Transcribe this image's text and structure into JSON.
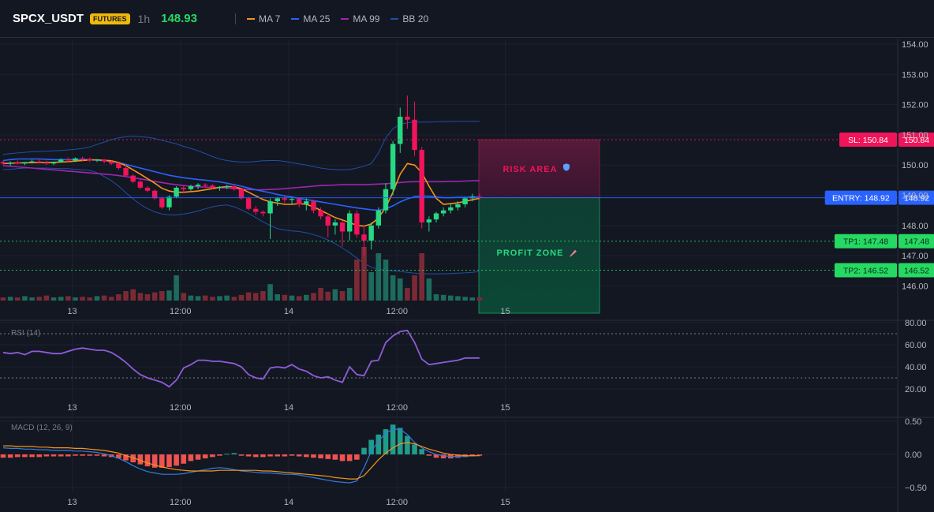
{
  "header": {
    "symbol": "SPCX_USDT",
    "badge": "FUTURES",
    "timeframe": "1h",
    "last_price": "148.93",
    "indicators": [
      {
        "label": "MA 7",
        "color": "#f7931a"
      },
      {
        "label": "MA 25",
        "color": "#2962ff"
      },
      {
        "label": "MA 99",
        "color": "#9c27b0"
      },
      {
        "label": "BB 20",
        "color": "#1e4fa8"
      }
    ]
  },
  "colors": {
    "up": "#26d982",
    "down": "#f0145a",
    "vol_up": "#1c6b5c",
    "vol_down": "#7a2a35",
    "bb": "#1e4fa8",
    "rsi": "#8e5cd9",
    "macd_line": "#2f7de0",
    "signal_line": "#f7931a"
  },
  "chart_data": [
    {
      "type": "candlestick",
      "title": "",
      "ylim": [
        145.6,
        154.2
      ],
      "yticks": [
        "154.00",
        "153.00",
        "152.00",
        "151.00",
        "150.00",
        "149.00",
        "148.00",
        "147.00",
        "146.00"
      ],
      "xticks": [
        "13",
        "12:00",
        "14",
        "12:00",
        "15"
      ],
      "xlim": [
        0,
        66
      ],
      "xtick_positions": [
        10,
        25,
        40,
        55,
        70
      ],
      "candles": [
        [
          150.1,
          150.15,
          150.0,
          150.05
        ],
        [
          150.05,
          150.12,
          149.98,
          150.08
        ],
        [
          150.08,
          150.15,
          150.02,
          150.05
        ],
        [
          150.05,
          150.1,
          150.0,
          150.1
        ],
        [
          150.1,
          150.18,
          150.05,
          150.12
        ],
        [
          150.12,
          150.2,
          150.05,
          150.08
        ],
        [
          150.08,
          150.15,
          150.0,
          150.05
        ],
        [
          150.05,
          150.12,
          150.0,
          150.1
        ],
        [
          150.1,
          150.22,
          150.08,
          150.18
        ],
        [
          150.18,
          150.25,
          150.1,
          150.15
        ],
        [
          150.15,
          150.25,
          150.1,
          150.22
        ],
        [
          150.22,
          150.28,
          150.12,
          150.2
        ],
        [
          150.2,
          150.25,
          150.1,
          150.15
        ],
        [
          150.15,
          150.2,
          150.1,
          150.18
        ],
        [
          150.18,
          150.2,
          150.05,
          150.12
        ],
        [
          150.12,
          150.15,
          150.0,
          150.05
        ],
        [
          150.05,
          150.1,
          149.85,
          149.9
        ],
        [
          149.9,
          150.0,
          149.6,
          149.65
        ],
        [
          149.65,
          149.7,
          149.4,
          149.45
        ],
        [
          149.45,
          149.5,
          149.2,
          149.25
        ],
        [
          149.25,
          149.3,
          149.1,
          149.15
        ],
        [
          149.15,
          149.2,
          148.85,
          148.9
        ],
        [
          148.9,
          148.95,
          148.55,
          148.6
        ],
        [
          148.6,
          149.0,
          148.5,
          148.95
        ],
        [
          148.95,
          149.3,
          148.9,
          149.25
        ],
        [
          149.25,
          149.3,
          149.1,
          149.2
        ],
        [
          149.2,
          149.35,
          149.15,
          149.3
        ],
        [
          149.3,
          149.4,
          149.2,
          149.35
        ],
        [
          149.35,
          149.4,
          149.25,
          149.32
        ],
        [
          149.32,
          149.38,
          149.2,
          149.25
        ],
        [
          149.25,
          149.3,
          149.15,
          149.28
        ],
        [
          149.28,
          149.35,
          149.2,
          149.3
        ],
        [
          149.3,
          149.35,
          149.15,
          149.2
        ],
        [
          149.2,
          149.25,
          148.85,
          148.9
        ],
        [
          148.9,
          148.95,
          148.5,
          148.55
        ],
        [
          148.55,
          148.65,
          148.35,
          148.45
        ],
        [
          148.45,
          148.5,
          148.3,
          148.4
        ],
        [
          148.4,
          148.9,
          147.55,
          148.8
        ],
        [
          148.8,
          148.95,
          148.65,
          148.9
        ],
        [
          148.9,
          149.0,
          148.75,
          148.85
        ],
        [
          148.85,
          148.95,
          148.7,
          148.88
        ],
        [
          148.88,
          148.9,
          148.6,
          148.7
        ],
        [
          148.7,
          148.9,
          148.5,
          148.8
        ],
        [
          148.8,
          148.85,
          148.4,
          148.5
        ],
        [
          148.5,
          148.6,
          148.2,
          148.3
        ],
        [
          148.3,
          148.4,
          147.6,
          148.0
        ],
        [
          148.0,
          148.2,
          147.7,
          148.1
        ],
        [
          148.1,
          148.15,
          147.3,
          147.8
        ],
        [
          147.8,
          148.5,
          147.5,
          148.4
        ],
        [
          148.4,
          148.5,
          147.6,
          147.7
        ],
        [
          147.7,
          148.0,
          147.0,
          147.5
        ],
        [
          147.5,
          148.1,
          147.2,
          148.0
        ],
        [
          148.0,
          148.6,
          147.9,
          148.5
        ],
        [
          148.5,
          149.4,
          148.4,
          149.2
        ],
        [
          149.2,
          150.8,
          149.0,
          150.7
        ],
        [
          150.7,
          151.9,
          150.4,
          151.6
        ],
        [
          151.6,
          152.3,
          151.2,
          151.5
        ],
        [
          151.5,
          152.1,
          150.3,
          150.5
        ],
        [
          150.5,
          150.6,
          147.9,
          148.1
        ],
        [
          148.1,
          148.3,
          147.8,
          148.2
        ],
        [
          148.2,
          148.45,
          148.1,
          148.4
        ],
        [
          148.4,
          148.6,
          148.3,
          148.5
        ],
        [
          148.5,
          148.7,
          148.4,
          148.6
        ],
        [
          148.6,
          148.8,
          148.5,
          148.7
        ],
        [
          148.7,
          148.95,
          148.6,
          148.9
        ],
        [
          148.9,
          149.05,
          148.8,
          148.95
        ],
        [
          148.95,
          149.05,
          148.85,
          148.93
        ]
      ],
      "ma7": [
        150.05,
        150.06,
        150.07,
        150.07,
        150.08,
        150.08,
        150.08,
        150.09,
        150.1,
        150.11,
        150.13,
        150.15,
        150.17,
        150.17,
        150.16,
        150.14,
        150.08,
        149.98,
        149.84,
        149.7,
        149.55,
        149.4,
        149.23,
        149.14,
        149.1,
        149.1,
        149.12,
        149.14,
        149.18,
        149.22,
        149.26,
        149.29,
        149.28,
        149.22,
        149.1,
        148.98,
        148.86,
        148.78,
        148.74,
        148.7,
        148.7,
        148.72,
        148.7,
        148.62,
        148.5,
        148.38,
        148.26,
        148.18,
        148.1,
        148.0,
        147.98,
        148.05,
        148.25,
        148.6,
        149.1,
        149.7,
        150.05,
        150.0,
        149.75,
        149.3,
        148.9,
        148.7,
        148.72,
        148.75,
        148.8,
        148.85,
        148.9
      ],
      "ma25": [
        150.15,
        150.18,
        150.2,
        150.2,
        150.2,
        150.2,
        150.19,
        150.18,
        150.18,
        150.18,
        150.18,
        150.18,
        150.18,
        150.16,
        150.14,
        150.12,
        150.08,
        150.02,
        149.96,
        149.9,
        149.84,
        149.78,
        149.72,
        149.66,
        149.62,
        149.58,
        149.55,
        149.52,
        149.5,
        149.47,
        149.44,
        149.4,
        149.35,
        149.3,
        149.24,
        149.18,
        149.13,
        149.08,
        149.03,
        148.98,
        148.94,
        148.9,
        148.86,
        148.82,
        148.78,
        148.74,
        148.7,
        148.66,
        148.62,
        148.58,
        148.55,
        148.52,
        148.5,
        148.55,
        148.65,
        148.78,
        148.88,
        148.95,
        148.98,
        148.96,
        148.94,
        148.92,
        148.92,
        148.93,
        148.93,
        148.94,
        148.94
      ],
      "ma99": [
        149.98,
        149.96,
        149.94,
        149.92,
        149.9,
        149.88,
        149.86,
        149.84,
        149.82,
        149.8,
        149.78,
        149.76,
        149.74,
        149.72,
        149.7,
        149.68,
        149.65,
        149.62,
        149.58,
        149.54,
        149.5,
        149.46,
        149.42,
        149.38,
        149.35,
        149.32,
        149.3,
        149.28,
        149.27,
        149.26,
        149.25,
        149.24,
        149.22,
        149.2,
        149.19,
        149.18,
        149.18,
        149.19,
        149.2,
        149.22,
        149.24,
        149.26,
        149.28,
        149.3,
        149.32,
        149.33,
        149.34,
        149.35,
        149.35,
        149.35,
        149.35,
        149.36,
        149.37,
        149.38,
        149.4,
        149.42,
        149.44,
        149.45,
        149.45,
        149.45,
        149.45,
        149.45,
        149.46,
        149.46,
        149.47,
        149.48,
        149.48
      ],
      "bb_upper": [
        150.35,
        150.38,
        150.4,
        150.42,
        150.44,
        150.45,
        150.46,
        150.47,
        150.48,
        150.5,
        150.52,
        150.55,
        150.6,
        150.68,
        150.76,
        150.84,
        150.9,
        150.94,
        150.95,
        150.94,
        150.92,
        150.88,
        150.82,
        150.76,
        150.7,
        150.62,
        150.55,
        150.47,
        150.38,
        150.28,
        150.2,
        150.15,
        150.12,
        150.1,
        150.1,
        150.12,
        150.14,
        150.15,
        150.15,
        150.12,
        150.08,
        150.04,
        150.0,
        149.95,
        149.9,
        149.87,
        149.85,
        149.84,
        149.85,
        149.9,
        149.96,
        150.05,
        150.4,
        150.9,
        151.2,
        151.35,
        151.4,
        151.42,
        151.42,
        151.42,
        151.43,
        151.44,
        151.44,
        151.45,
        151.45,
        151.45,
        151.45
      ],
      "bb_lower": [
        149.85,
        149.86,
        149.88,
        149.9,
        149.9,
        149.9,
        149.9,
        149.89,
        149.88,
        149.88,
        149.86,
        149.84,
        149.82,
        149.75,
        149.62,
        149.48,
        149.3,
        149.08,
        148.88,
        148.7,
        148.56,
        148.45,
        148.38,
        148.35,
        148.35,
        148.38,
        148.42,
        148.48,
        148.55,
        148.62,
        148.66,
        148.68,
        148.62,
        148.52,
        148.4,
        148.26,
        148.12,
        148.0,
        147.9,
        147.85,
        147.82,
        147.8,
        147.76,
        147.7,
        147.62,
        147.52,
        147.4,
        147.25,
        147.1,
        146.92,
        146.75,
        146.62,
        146.55,
        146.52,
        146.5,
        146.48,
        146.45,
        146.42,
        146.4,
        146.4,
        146.4,
        146.4,
        146.41,
        146.42,
        146.43,
        146.45,
        146.48
      ],
      "volume": [
        0.5,
        0.6,
        0.5,
        0.7,
        0.5,
        0.6,
        0.8,
        0.5,
        0.6,
        0.7,
        0.5,
        0.6,
        0.5,
        0.7,
        0.8,
        0.6,
        1.0,
        1.5,
        1.8,
        1.2,
        1.0,
        1.3,
        1.5,
        1.6,
        4.0,
        1.2,
        0.8,
        0.7,
        0.8,
        0.6,
        0.7,
        0.8,
        0.6,
        0.9,
        1.3,
        1.2,
        1.5,
        2.6,
        1.0,
        0.9,
        0.8,
        0.7,
        0.9,
        1.2,
        2.0,
        1.4,
        1.8,
        1.5,
        2.0,
        6.5,
        8.5,
        4.5,
        7.5,
        6.5,
        4.0,
        3.5,
        2.0,
        4.0,
        7.5,
        3.5,
        1.0,
        0.9,
        0.8,
        0.7,
        0.6,
        0.5,
        0.5
      ],
      "lines": [
        {
          "label": "SL: 150.84",
          "value": 150.84,
          "price_tag": "150.84",
          "color": "#f0145a"
        },
        {
          "label": "ENTRY: 148.92",
          "value": 148.92,
          "price_tag": "148.92",
          "color": "#2962ff"
        },
        {
          "label": "TP1: 147.48",
          "value": 147.48,
          "price_tag": "147.48",
          "color": "#26d962"
        },
        {
          "label": "TP2: 146.52",
          "value": 146.52,
          "price_tag": "146.52",
          "color": "#26d962"
        }
      ],
      "zones": [
        {
          "label": "RISK AREA",
          "from": 148.92,
          "to": 150.84,
          "color": "#f0145a",
          "icon": "shield-icon"
        },
        {
          "label": "PROFIT ZONE",
          "from": 145.6,
          "to": 148.92,
          "color": "#1fbf78",
          "icon": "rocket-icon"
        }
      ]
    },
    {
      "type": "line",
      "title": "RSI (14)",
      "ylim": [
        15,
        80
      ],
      "yticks": [
        80,
        60,
        40,
        20
      ],
      "ytick_labels": [
        "80.00",
        "60.00",
        "40.00",
        "20.00"
      ],
      "bands": [
        70,
        30
      ],
      "xticks": [
        "13",
        "12:00",
        "14",
        "12:00",
        "15"
      ],
      "values": [
        53,
        52,
        53,
        51,
        54,
        54,
        53,
        52,
        52,
        54,
        56,
        57,
        56,
        55,
        55,
        53,
        49,
        44,
        38,
        33,
        30,
        28,
        26,
        22,
        28,
        39,
        42,
        46,
        46,
        45,
        45,
        44,
        43,
        40,
        33,
        30,
        29,
        39,
        40,
        39,
        42,
        38,
        36,
        32,
        30,
        31,
        28,
        26,
        40,
        33,
        32,
        45,
        46,
        62,
        68,
        72,
        73,
        62,
        47,
        42,
        43,
        44,
        45,
        46,
        48,
        48,
        48
      ]
    },
    {
      "type": "bar+line",
      "title": "MACD (12, 26, 9)",
      "ylim": [
        -0.55,
        0.62
      ],
      "yticks": [
        0.5,
        0.0,
        -0.5
      ],
      "ytick_labels": [
        "0.50",
        "0.00",
        "−0.50"
      ],
      "xticks": [
        "13",
        "12:00",
        "14",
        "12:00",
        "15"
      ],
      "histogram": [
        -0.05,
        -0.05,
        -0.04,
        -0.04,
        -0.04,
        -0.04,
        -0.03,
        -0.03,
        -0.03,
        -0.03,
        -0.02,
        -0.02,
        -0.02,
        -0.02,
        -0.03,
        -0.04,
        -0.06,
        -0.09,
        -0.12,
        -0.15,
        -0.18,
        -0.2,
        -0.2,
        -0.19,
        -0.17,
        -0.14,
        -0.1,
        -0.08,
        -0.06,
        -0.04,
        -0.02,
        0.01,
        0.02,
        -0.02,
        -0.03,
        -0.04,
        -0.04,
        -0.03,
        -0.03,
        -0.03,
        -0.02,
        -0.03,
        -0.04,
        -0.05,
        -0.06,
        -0.07,
        -0.08,
        -0.1,
        -0.1,
        -0.08,
        0.1,
        0.22,
        0.3,
        0.38,
        0.45,
        0.4,
        0.28,
        0.15,
        0.08,
        -0.02,
        -0.05,
        -0.06,
        -0.06,
        -0.05,
        -0.04,
        -0.03,
        -0.02
      ],
      "macd": [
        0.1,
        0.09,
        0.09,
        0.08,
        0.08,
        0.07,
        0.07,
        0.06,
        0.06,
        0.06,
        0.05,
        0.05,
        0.04,
        0.03,
        0.01,
        -0.02,
        -0.06,
        -0.11,
        -0.17,
        -0.22,
        -0.26,
        -0.28,
        -0.3,
        -0.3,
        -0.3,
        -0.29,
        -0.27,
        -0.25,
        -0.23,
        -0.21,
        -0.2,
        -0.21,
        -0.23,
        -0.25,
        -0.26,
        -0.27,
        -0.28,
        -0.28,
        -0.29,
        -0.3,
        -0.3,
        -0.31,
        -0.33,
        -0.35,
        -0.37,
        -0.39,
        -0.41,
        -0.42,
        -0.43,
        -0.4,
        -0.2,
        0.05,
        0.2,
        0.32,
        0.38,
        0.38,
        0.3,
        0.18,
        0.1,
        0.04,
        0.0,
        -0.02,
        -0.03,
        -0.03,
        -0.03,
        -0.02,
        -0.02
      ],
      "signal": [
        0.13,
        0.13,
        0.12,
        0.12,
        0.12,
        0.11,
        0.11,
        0.1,
        0.1,
        0.1,
        0.09,
        0.09,
        0.08,
        0.07,
        0.06,
        0.04,
        0.02,
        -0.02,
        -0.05,
        -0.09,
        -0.13,
        -0.16,
        -0.19,
        -0.21,
        -0.23,
        -0.24,
        -0.25,
        -0.25,
        -0.25,
        -0.25,
        -0.24,
        -0.24,
        -0.24,
        -0.24,
        -0.24,
        -0.24,
        -0.25,
        -0.25,
        -0.26,
        -0.27,
        -0.28,
        -0.29,
        -0.3,
        -0.31,
        -0.32,
        -0.33,
        -0.35,
        -0.36,
        -0.37,
        -0.37,
        -0.32,
        -0.2,
        -0.08,
        0.02,
        0.1,
        0.16,
        0.18,
        0.16,
        0.12,
        0.08,
        0.05,
        0.02,
        0.0,
        -0.01,
        -0.02,
        -0.02,
        -0.02
      ]
    }
  ]
}
